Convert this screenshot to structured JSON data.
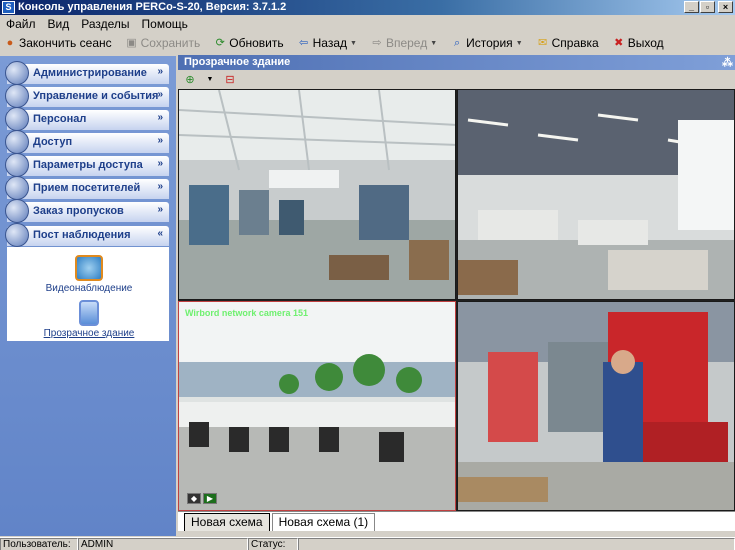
{
  "window": {
    "title": "Консоль управления PERCo-S-20, Версия: 3.7.1.2",
    "icon_glyph": "S",
    "buttons": {
      "minimize": "_",
      "maximize": "▫",
      "close": "×"
    }
  },
  "menu": [
    "Файл",
    "Вид",
    "Разделы",
    "Помощь"
  ],
  "toolbar": {
    "end_session": "Закончить сеанс",
    "save": "Сохранить",
    "refresh": "Обновить",
    "back": "Назад",
    "forward": "Вперед",
    "history": "История",
    "help": "Справка",
    "exit": "Выход"
  },
  "icons": {
    "chevron_down": "»",
    "chevron_up": "«",
    "dropdown": "▼"
  },
  "sidebar": {
    "items": [
      {
        "label": "Администрирование",
        "expanded": false
      },
      {
        "label": "Управление и события",
        "expanded": false
      },
      {
        "label": "Персонал",
        "expanded": false
      },
      {
        "label": "Доступ",
        "expanded": false
      },
      {
        "label": "Параметры доступа",
        "expanded": false
      },
      {
        "label": "Прием посетителей",
        "expanded": false
      },
      {
        "label": "Заказ пропусков",
        "expanded": false
      },
      {
        "label": "Пост наблюдения",
        "expanded": true
      }
    ],
    "panel_entries": [
      {
        "label": "Видеонаблюдение"
      },
      {
        "label": "Прозрачное здание"
      }
    ]
  },
  "content": {
    "title": "Прозрачное здание",
    "cameras": [
      {
        "label": ""
      },
      {
        "label": ""
      },
      {
        "label": "Wirbord network camera 151"
      },
      {
        "label": ""
      }
    ],
    "tabs": [
      "Новая схема",
      "Новая схема (1)"
    ],
    "active_tab": 0
  },
  "status": {
    "user_label": "Пользователь:",
    "user_value": "ADMIN",
    "status_label": "Статус:",
    "status_value": ""
  },
  "colors": {
    "sidebar_bg": "#6184c8",
    "header_bg": "#4e6fb3",
    "title_bar": "#0a246a"
  }
}
